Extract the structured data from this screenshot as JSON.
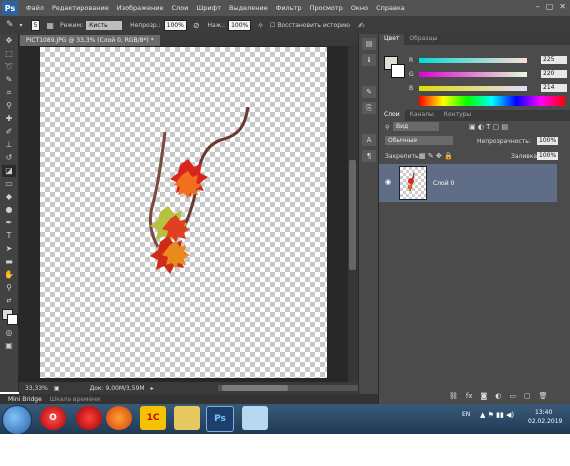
{
  "app": {
    "logo": "Ps"
  },
  "menu": [
    "Файл",
    "Редактирование",
    "Изображение",
    "Слои",
    "Шрифт",
    "Выделение",
    "Фильтр",
    "Просмотр",
    "Окно",
    "Справка"
  ],
  "window_controls": [
    "–",
    "▢",
    "✕"
  ],
  "options": {
    "brush_size": "5",
    "mode_label": "Режим:",
    "mode_value": "Кисть",
    "opacity_label": "Непрозр.:",
    "opacity_value": "100%",
    "pressure_label": "Наж.:",
    "pressure_value": "100%",
    "restore_label": "Восстановить историю"
  },
  "document": {
    "tab_title": "PICT1089.JPG @ 33,3% (Слой 0, RGB/8*) *",
    "zoom": "33,33%",
    "doc_info": "Док: 9,00M/3,59M"
  },
  "bridge": {
    "tab1": "Mini Bridge",
    "tab2": "Шкала времени"
  },
  "color_panel": {
    "tabs": [
      "Цвет",
      "Образцы"
    ],
    "channels": [
      {
        "name": "R",
        "value": "225",
        "color": "#e0107a"
      },
      {
        "name": "G",
        "value": "220",
        "color": "#6a6a20"
      },
      {
        "name": "B",
        "value": "214",
        "color": "#2020d8"
      }
    ]
  },
  "layers_panel": {
    "tabs": [
      "Слои",
      "Каналы",
      "Контуры"
    ],
    "filter_label": "Вид",
    "blend_mode": "Обычные",
    "opacity_label": "Непрозрачность:",
    "opacity_value": "100%",
    "lock_label": "Закрепить:",
    "fill_label": "Заливка:",
    "fill_value": "100%",
    "layer_name": "Слой 0",
    "bottom_icons": [
      "link-icon",
      "fx-icon",
      "mask-icon",
      "adjustment-icon",
      "folder-icon",
      "new-layer-icon",
      "trash-icon"
    ]
  },
  "taskbar": {
    "lang": "EN",
    "time": "13:40",
    "date": "02.02.2019",
    "apps": [
      "opera",
      "firefox",
      "yandex",
      "1c",
      "explorer",
      "photoshop",
      "paint"
    ]
  },
  "colors": {
    "accent_layer": "#5f6e86",
    "ps_blue": "#2c63a8"
  }
}
